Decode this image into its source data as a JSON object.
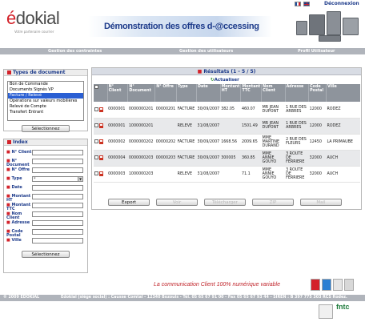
{
  "header": {
    "logo_prefix": "é",
    "logo_main": "dokial",
    "logo_sub": "Votre partenaire courrier",
    "banner_title": "Démonstration des offres d-@ccessing",
    "logout_label": "Déconnexion"
  },
  "nav": {
    "items": [
      "Gestion des contraintes",
      "Gestion des utilisateurs",
      "Profil Utilisateur"
    ]
  },
  "doc_types": {
    "title": "Types de document",
    "items": [
      "Bon de Commande",
      "Documents Signés VP",
      "Facture / Relevé",
      "Opérations sur valeurs mobilières",
      "Relevé de Compte",
      "Transfert Entrant"
    ],
    "selected_index": 2,
    "select_button": "Sélectionnez"
  },
  "index": {
    "title": "Index",
    "fields": [
      {
        "label": "N° Client",
        "value": ""
      },
      {
        "label": "N° Document",
        "value": ""
      },
      {
        "label": "N° Offre",
        "value": ""
      },
      {
        "label": "Type",
        "value": "*"
      },
      {
        "label": "Date",
        "value": ""
      },
      {
        "label": "Montant HT",
        "value": ""
      },
      {
        "label": "Montant TTC",
        "value": ""
      },
      {
        "label": "Nom Client",
        "value": ""
      },
      {
        "label": "Adresse",
        "value": ""
      },
      {
        "label": "Code Postal",
        "value": ""
      },
      {
        "label": "Ville",
        "value": ""
      }
    ],
    "select_button": "Sélectionnez"
  },
  "results": {
    "title": "Résultats (1 - 5 / 5)",
    "refresh_label": "Actualiser",
    "columns": [
      "N° Client",
      "N° Document",
      "N° Offre",
      "Type",
      "Date",
      "Montant HT",
      "Montant TTC",
      "Nom Client",
      "Adresse",
      "Code Postal",
      "Ville"
    ],
    "rows": [
      [
        "0000001",
        "0000000201",
        "00000201",
        "FACTURE",
        "30/09/2007",
        "382.05",
        "460.07",
        "MR JEAN DUPONT",
        "1 RUE DES ARBRES",
        "12000",
        "RODEZ"
      ],
      [
        "0000001",
        "1000000201",
        "",
        "RELEVE",
        "31/08/2007",
        "",
        "1501.49",
        "MR JEAN DUPONT",
        "1 RUE DES ARBRES",
        "12000",
        "RODEZ"
      ],
      [
        "0000002",
        "0000000202",
        "00000202",
        "FACTURE",
        "30/09/2007",
        "1668.56",
        "2009.65",
        "MME MARTINE DURAND",
        "2 RUE DES FLEURS",
        "12450",
        "LA PRIMAUBE"
      ],
      [
        "0000004",
        "0000000203",
        "00000203",
        "FACTURE",
        "30/09/2007",
        "300005",
        "360.85",
        "MME ANNIE GOUYO",
        "3 ROUTE DE FERRIERE",
        "32000",
        "AUCH"
      ],
      [
        "0000003",
        "1000000203",
        "",
        "RELEVE",
        "31/08/2007",
        "",
        "71.1",
        "MME ANNIE GOUYO",
        "3 ROUTE DE FERRIERE",
        "32000",
        "AUCH"
      ]
    ],
    "actions": [
      "Export",
      "Voir",
      "Télécharger",
      "ZIP",
      "Mail"
    ]
  },
  "footer": {
    "ad_text": "La communication Client 100% numérique variable",
    "copyright": "© 2009 EDOKIAL",
    "address": "Edokial (siège social) : Causse Comtal - 12340 Bozouls - Tél. 05 65 67 91 00 - Fax 05 65 67 93 44 - SIREN : B 397 775 303 RCS Rodez.",
    "partner": "fntc"
  }
}
